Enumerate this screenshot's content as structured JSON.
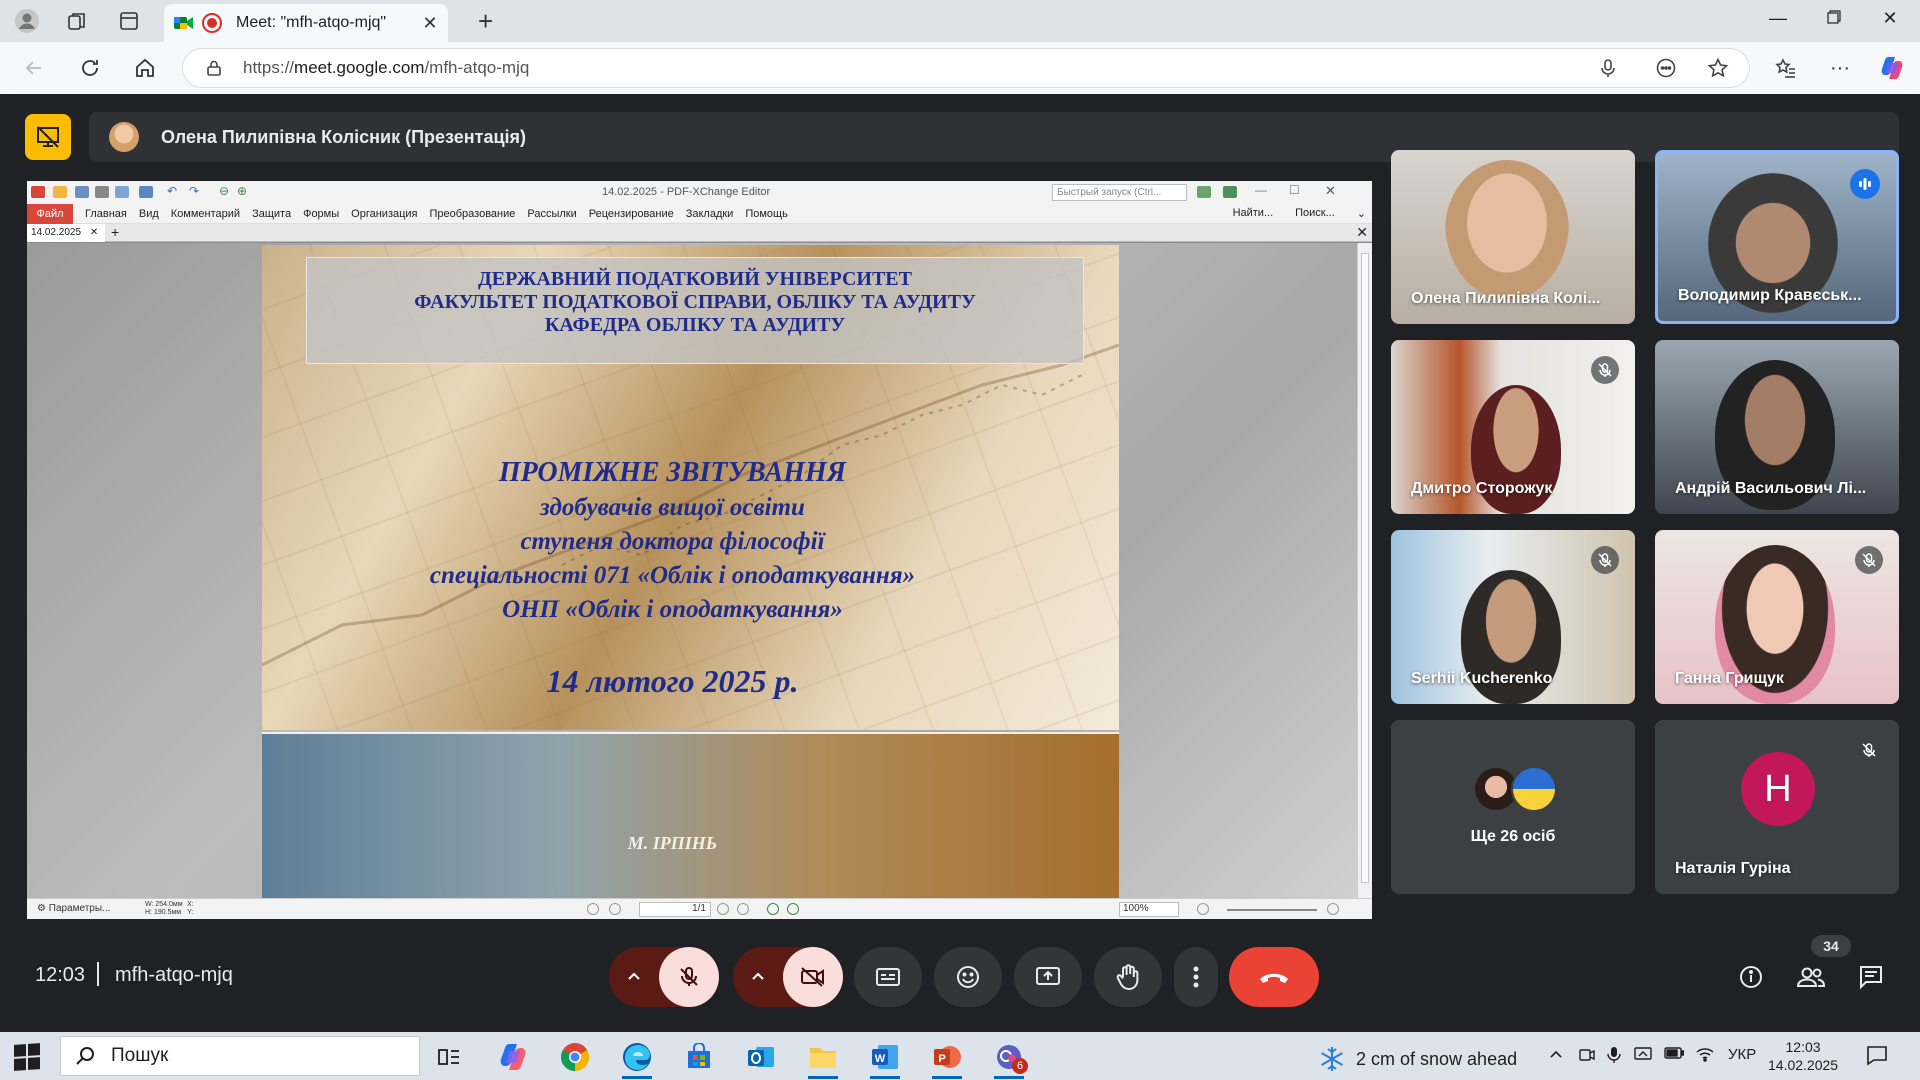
{
  "browser": {
    "tab_title": "Meet: \"mfh-atqo-mjq\"",
    "url_prefix": "https://",
    "url_host": "meet.google.com",
    "url_path": "/mfh-atqo-mjq"
  },
  "presenter": {
    "label": "Олена Пилипівна Колісник (Презентація)"
  },
  "pdf_editor": {
    "window_title": "14.02.2025 - PDF-XChange Editor",
    "quick_launch_placeholder": "Быстрый запуск (Ctrl...",
    "menu": [
      "Файл",
      "Главная",
      "Вид",
      "Комментарий",
      "Защита",
      "Формы",
      "Организация",
      "Преобразование",
      "Рассылки",
      "Рецензирование",
      "Закладки",
      "Помощь"
    ],
    "menu_right": [
      "Найти...",
      "Поиск..."
    ],
    "doc_tab": "14.02.2025",
    "status_params": "Параметры...",
    "status_dims_w": "W: 254.0мм",
    "status_dims_h": "H: 190.5мм",
    "status_coords_x": "X:",
    "status_coords_y": "Y:",
    "page_indicator": "1/1",
    "zoom": "100%"
  },
  "slide": {
    "header_lines": [
      "ДЕРЖАВНИЙ ПОДАТКОВИЙ УНІВЕРСИТЕТ",
      "ФАКУЛЬТЕТ ПОДАТКОВОЇ СПРАВИ, ОБЛІКУ ТА АУДИТУ",
      "КАФЕДРА ОБЛІКУ ТА АУДИТУ"
    ],
    "title": "ПРОМІЖНЕ ЗВІТУВАННЯ",
    "lines": [
      "здобувачів вищої освіти",
      "ступеня доктора філософії",
      "спеціальності 071 «Облік і оподаткування»",
      "ОНП «Облік і оподаткування»"
    ],
    "date": "14 лютого 2025 р.",
    "city": "М. ІРПІНЬ"
  },
  "participants": [
    {
      "name": "Олена Пилипівна Колі...",
      "muted": false,
      "speaking": false
    },
    {
      "name": "Володимир Кравєськ...",
      "muted": false,
      "speaking": true
    },
    {
      "name": "Дмитро Сторожук",
      "muted": true,
      "speaking": false
    },
    {
      "name": "Андрій Васильович Лі...",
      "muted": false,
      "speaking": false
    },
    {
      "name": "Serhii Kucherenko",
      "muted": true,
      "speaking": false
    },
    {
      "name": "Ганна Грищук",
      "muted": true,
      "speaking": false
    },
    {
      "name": "Ще 26 осіб",
      "muted": false,
      "speaking": false
    },
    {
      "name": "Наталія Гуріна",
      "initial": "Н",
      "muted": true,
      "speaking": false
    }
  ],
  "meeting": {
    "time": "12:03",
    "code": "mfh-atqo-mjq",
    "participant_count": "34"
  },
  "taskbar": {
    "search_placeholder": "Пошук",
    "weather": "2 cm of snow ahead",
    "language": "УКР",
    "time": "12:03",
    "date": "14.02.2025",
    "teams_badge": "6"
  },
  "colors": {
    "meet_bg": "#202124",
    "hangup": "#ea4335",
    "presenting_icon": "#fbbc04",
    "avatar_n": "#c2185b",
    "slide_text": "#1f2c8c"
  }
}
